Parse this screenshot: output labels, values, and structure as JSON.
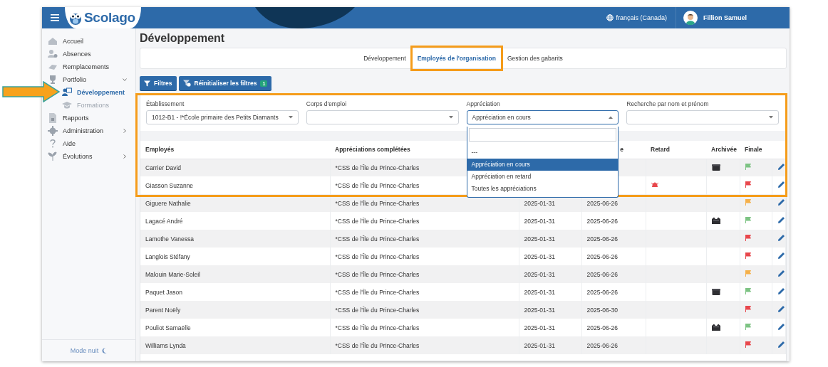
{
  "header": {
    "logo": "Scolago",
    "language": "français (Canada)",
    "user": "Fillion Samuel"
  },
  "sidebar": {
    "items": [
      {
        "label": "Accueil",
        "selected": false
      },
      {
        "label": "Absences",
        "selected": false
      },
      {
        "label": "Remplacements",
        "selected": false
      },
      {
        "label": "Portfolio",
        "selected": false,
        "expanded": true,
        "children": [
          {
            "label": "Développement",
            "selected": true,
            "disabled": false
          },
          {
            "label": "Formations",
            "selected": false,
            "disabled": true
          }
        ]
      },
      {
        "label": "Rapports",
        "selected": false
      },
      {
        "label": "Administration",
        "selected": false,
        "expanded": false
      },
      {
        "label": "Aide",
        "selected": false
      },
      {
        "label": "Évolutions",
        "selected": false,
        "expanded": false
      }
    ],
    "footer": "Mode nuit"
  },
  "page_title": "Développement",
  "tabs": [
    {
      "label": "Développement",
      "selected": false
    },
    {
      "label": "Employés de l'organisation",
      "selected": true
    },
    {
      "label": "Gestion des gabarits",
      "selected": false
    }
  ],
  "buttons": [
    {
      "label": "Filtres"
    },
    {
      "label": "Réinitialiser les filtres",
      "badge": "1"
    }
  ],
  "filters": [
    {
      "label": "Établissement",
      "value": "1012-B1 - !*École primaire des Petits Diamants",
      "expanded": false
    },
    {
      "label": "Corps d'emploi",
      "expanded": false
    },
    {
      "label": "Appréciation",
      "value": "Appréciation en cours",
      "expanded": true,
      "options": [
        {
          "label": "---",
          "selected": false
        },
        {
          "label": "Appréciation en cours",
          "selected": true
        },
        {
          "label": "Appréciation en retard",
          "selected": false
        },
        {
          "label": "Toutes les appréciations",
          "selected": false
        }
      ]
    },
    {
      "label": "Recherche par nom et prénom",
      "expanded": false
    }
  ],
  "table": {
    "columns": {
      "column_1": "Employés",
      "column_2": "Appréciations complétées",
      "column_4": "e",
      "column_5": "Retard",
      "column_6": "Archivée",
      "column_7": "Finale"
    },
    "rows": [
      {
        "employee": "Carrier David",
        "completed": "*CSS de l'Île du Prince-Charles",
        "late": false,
        "archive": {
          "kind": "box"
        },
        "finale": {
          "color": "#7dc383"
        }
      },
      {
        "employee": "Giasson Suzanne",
        "completed": "*CSS de l'Île du Prince-Charles",
        "late": true,
        "finale": {
          "color": "#e8474c"
        }
      },
      {
        "employee": "Giguere Nathalie",
        "completed": "*CSS de l'Île du Prince-Charles",
        "column_3": "2025-01-31",
        "column_4": "2025-06-26",
        "late": false,
        "finale": {
          "color": "#f5b04a"
        }
      },
      {
        "employee": "Lagacé André",
        "completed": "*CSS de l'Île du Prince-Charles",
        "column_3": "2025-01-31",
        "column_4": "2025-06-26",
        "late": false,
        "archive": {
          "kind": "tray"
        },
        "finale": {
          "color": "#7dc383"
        }
      },
      {
        "employee": "Lamothe Vanessa",
        "completed": "*CSS de l'Île du Prince-Charles",
        "column_3": "2025-01-31",
        "column_4": "2025-06-26",
        "late": false,
        "finale": {
          "color": "#e8474c"
        }
      },
      {
        "employee": "Langlois Stéfany",
        "completed": "*CSS de l'Île du Prince-Charles",
        "column_3": "2025-01-31",
        "column_4": "2025-06-26",
        "late": false,
        "finale": {
          "color": "#e8474c"
        }
      },
      {
        "employee": "Malouin Marie-Soleil",
        "completed": "*CSS de l'Île du Prince-Charles",
        "column_3": "2025-01-31",
        "column_4": "2025-06-26",
        "late": false,
        "finale": {
          "color": "#f5b04a"
        }
      },
      {
        "employee": "Paquet Jason",
        "completed": "*CSS de l'Île du Prince-Charles",
        "column_3": "2025-01-31",
        "column_4": "2025-06-26",
        "late": false,
        "archive": {
          "kind": "box"
        },
        "finale": {
          "color": "#7dc383"
        }
      },
      {
        "employee": "Parent Noëly",
        "completed": "*CSS de l'Île du Prince-Charles",
        "column_3": "2025-01-31",
        "column_4": "2025-06-30",
        "late": false,
        "finale": {
          "color": "#e8474c"
        }
      },
      {
        "employee": "Pouliot Samaëlle",
        "completed": "*CSS de l'Île du Prince-Charles",
        "column_3": "2025-01-31",
        "column_4": "2025-06-26",
        "late": false,
        "archive": {
          "kind": "tray"
        },
        "finale": {
          "color": "#7dc383"
        }
      },
      {
        "employee": "Williams Lynda",
        "completed": "*CSS de l'Île du Prince-Charles",
        "column_3": "2025-01-31",
        "column_4": "2025-06-26",
        "late": false,
        "finale": {
          "color": "#e8474c"
        }
      }
    ]
  }
}
